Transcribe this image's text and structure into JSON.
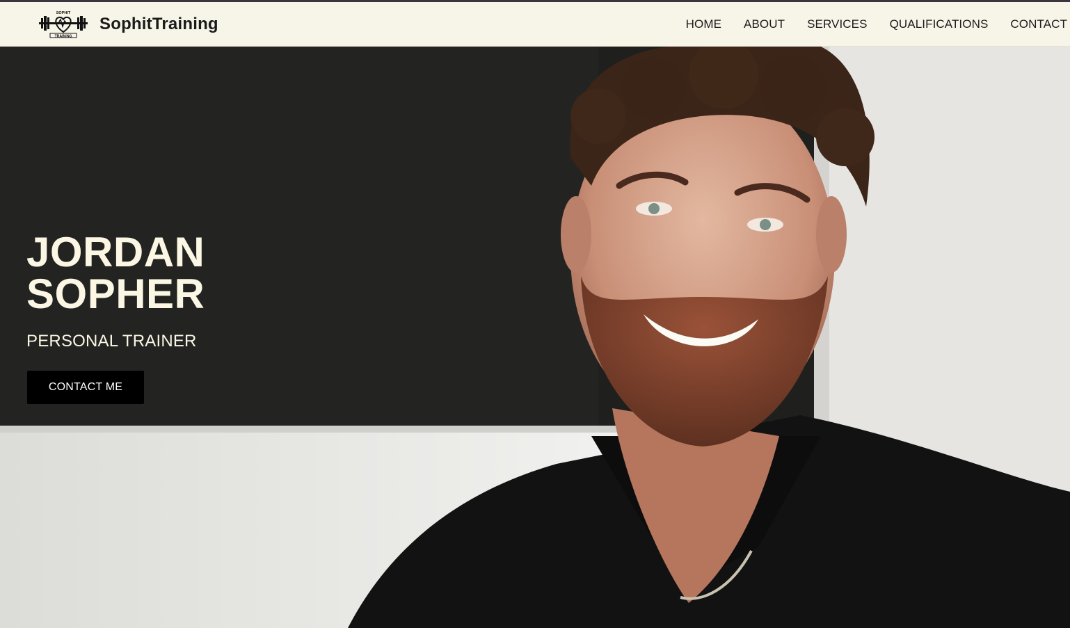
{
  "brand": {
    "logo_text_top": "SOPHIT",
    "logo_text_bottom": "TRAINING",
    "name": "SophitTraining"
  },
  "nav": {
    "items": [
      {
        "label": "HOME"
      },
      {
        "label": "ABOUT"
      },
      {
        "label": "SERVICES"
      },
      {
        "label": "QUALIFICATIONS"
      },
      {
        "label": "CONTACT"
      }
    ]
  },
  "hero": {
    "name_line1": "JORDAN",
    "name_line2": "SOPHER",
    "role": "PERSONAL TRAINER",
    "cta_label": "CONTACT ME",
    "image": "hero-portrait-photo"
  },
  "colors": {
    "navbar_bg": "#f7f4e8",
    "hero_text": "#fbf7e4",
    "cta_bg": "#000000",
    "cta_text": "#ffffff"
  }
}
